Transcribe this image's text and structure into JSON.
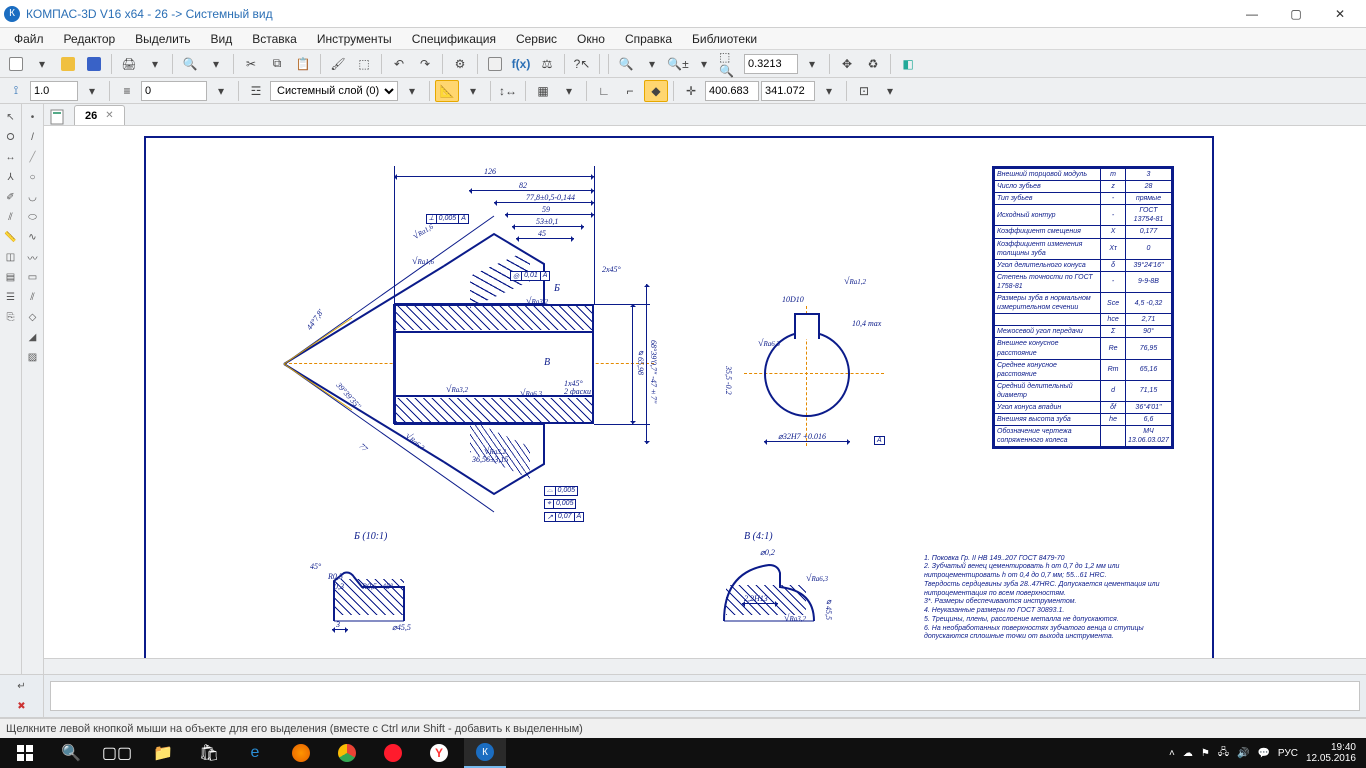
{
  "title": "КОМПАС-3D V16  x64 - 26 -> Системный вид",
  "menu": [
    "Файл",
    "Редактор",
    "Выделить",
    "Вид",
    "Вставка",
    "Инструменты",
    "Спецификация",
    "Сервис",
    "Окно",
    "Справка",
    "Библиотеки"
  ],
  "toolbar1": {
    "zoom_value": "0.3213"
  },
  "toolbar2": {
    "scale": "1.0",
    "style": "0",
    "layer": "Системный слой (0)",
    "coord_x": "400.683",
    "coord_y": "341.072"
  },
  "tab": {
    "label": "26"
  },
  "status": "Щелкните левой кнопкой мыши на объекте для его выделения (вместе с Ctrl или Shift - добавить к выделенным)",
  "tray": {
    "lang": "РУС",
    "time": "19:40",
    "date": "12.05.2016"
  },
  "drawing": {
    "dims": {
      "len_overall": "126",
      "len_b": "82",
      "len_c": "77,8±0,5-0,144",
      "len_d": "59",
      "len_e": "53±0,1",
      "len_f": "45",
      "len_g": "77",
      "cham1": "2x45°",
      "cham2": "1x45°\n2 фаски",
      "thread": "36,56±3,15",
      "dia_outer": "⌀65,98",
      "dia_inner": "⌀32H7 +0.016",
      "dia_bore": "⌀35,5 -0.2",
      "ang1": "44°7,8'",
      "ang2": "39°39'35''",
      "ang3": "68°39'0,7\"  -47±7''",
      "sf1": "Ra1,6",
      "sf2": "Ra1,6",
      "sf3": "Ra3,2",
      "sf4": "Ra3,2",
      "sf5": "Ra6,3",
      "sf6": "Ra1,2",
      "sf7": "Ra6,3",
      "sf8": "Ra3,2",
      "tol1_sym": "⟂",
      "tol1_val": "0,005",
      "tol1_ref": "А",
      "tol2_sym": "◎",
      "tol2_val": "0,01",
      "tol2_ref": "А",
      "tol3_sym": "⌓",
      "tol3_val": "0,005",
      "tol4_sym": "⌖",
      "tol4_val": "0,005",
      "tol5_sym": "↗",
      "tol5_val": "0,07",
      "tol5_ref": "А",
      "datum_A": "А",
      "ev_dia": "⌀32H7 +0.016",
      "ev_key": "10D10",
      "ev_keyh": "10,4 max",
      "ev_sf": "Ra6,3",
      "ev_h": "35,5 -0.2"
    },
    "detailB": {
      "label": "Б (10:1)",
      "r1": "R0,5",
      "r2": "R0,5",
      "d1": "0,3",
      "d2": "3",
      "ang": "45°",
      "ang2": "45°",
      "grind": "⌀45,5"
    },
    "detailV": {
      "label": "В (4:1)",
      "d1": "⌀0,2",
      "d2": "2,2H13",
      "sf1": "Ra6,3",
      "sf2": "Ra3,2",
      "h": "⌀45,5"
    },
    "gear_table": [
      [
        "Внешний торцовой модуль",
        "m",
        "3"
      ],
      [
        "Число зубьев",
        "z",
        "28"
      ],
      [
        "Тип зубьев",
        "-",
        "прямые"
      ],
      [
        "Исходный контур",
        "-",
        "ГОСТ 13754-81"
      ],
      [
        "Коэффициент смещения",
        "X",
        "0,177"
      ],
      [
        "Коэффициент изменения толщины зуба",
        "Xτ",
        "0"
      ],
      [
        "Угол делительного конуса",
        "δ",
        "39°24'16\""
      ],
      [
        "Степень точности по ГОСТ 1758-81",
        "-",
        "9-9-8B"
      ],
      [
        "Размеры зуба в нормальном измерительном сечении",
        "Sce",
        "4,5 -0,32"
      ],
      [
        "",
        "hce",
        "2,71"
      ],
      [
        "Межосевой угол передачи",
        "Σ",
        "90°"
      ],
      [
        "Внешнее конусное расстояние",
        "Re",
        "76,95"
      ],
      [
        "Среднее конусное расстояние",
        "Rm",
        "65,16"
      ],
      [
        "Средний делительный диаметр",
        "d",
        "71,15"
      ],
      [
        "Угол конуса впадин",
        "δf",
        "36°4'01\""
      ],
      [
        "Внешняя высота зуба",
        "he",
        "6,6"
      ],
      [
        "Обозначение чертежа сопряженного колеса",
        "",
        "МЧ 13.06.03.027"
      ]
    ],
    "notes": [
      "1. Поковка Гр. II НВ 149..207 ГОСТ 8479-70",
      "2. Зубчатый венец цементировать h от 0,7 до 1,2 мм или нитроцементировать h от 0,4 до 0,7 мм; 55...61 HRC.",
      "Твердость сердцевины зуба 28..47HRC. Допускается цементация или нитроцементация по всем поверхностям.",
      "3*. Размеры обеспечиваются инструментом.",
      "4. Неуказанные размеры по ГОСТ 30893.1.",
      "5. Трещины, плены, расслоение металла не допускаются.",
      "6. На необработанных поверхностях зубчатого венца и ступицы допускаются сплошные точки от выхода инструмента."
    ]
  }
}
